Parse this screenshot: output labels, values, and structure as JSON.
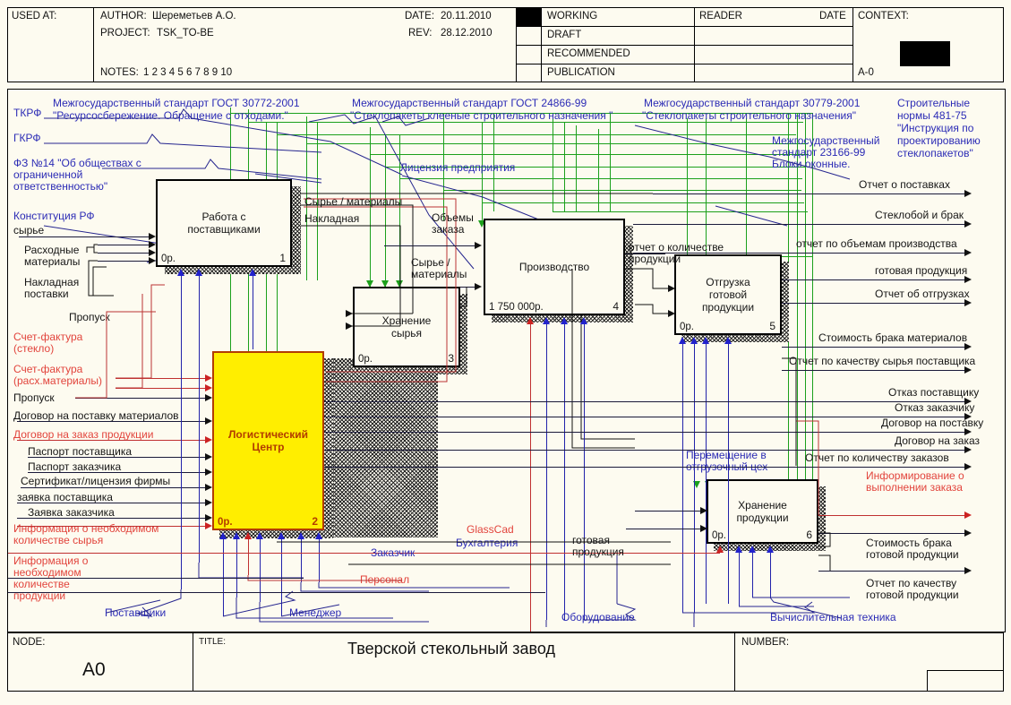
{
  "header": {
    "used_at_label": "USED AT:",
    "author_label": "AUTHOR:",
    "author_value": "Шереметьев А.О.",
    "project_label": "PROJECT:",
    "project_value": "TSK_TO-BE",
    "date_label": "DATE:",
    "date_value": "20.11.2010",
    "rev_label": "REV:",
    "rev_value": "28.12.2010",
    "notes_label": "NOTES:",
    "notes_value": "1  2  3  4  5  6  7  8  9  10",
    "status": [
      {
        "label": "WORKING",
        "checked": true
      },
      {
        "label": "DRAFT",
        "checked": false
      },
      {
        "label": "RECOMMENDED",
        "checked": false
      },
      {
        "label": "PUBLICATION",
        "checked": false
      }
    ],
    "reader_label": "READER",
    "reader_date_label": "DATE",
    "context_label": "CONTEXT:",
    "context_node": "A-0"
  },
  "footer": {
    "node_label": "NODE:",
    "node_value": "A0",
    "title_label": "TITLE:",
    "title_value": "Тверской стекольный завод",
    "number_label": "NUMBER:"
  },
  "activities": [
    {
      "id": "a1",
      "name": "Работа с\nпоставщиками",
      "cost": "0р.",
      "number": "1"
    },
    {
      "id": "a2",
      "name": "Логистический\nЦентр",
      "cost": "0р.",
      "number": "2",
      "highlight": "#ffee00"
    },
    {
      "id": "a3",
      "name": "Хранение\nсырья",
      "cost": "0р.",
      "number": "3"
    },
    {
      "id": "a4",
      "name": "Производство",
      "cost": "1 750 000р.",
      "number": "4"
    },
    {
      "id": "a5",
      "name": "Отгрузка\nготовой\nпродукции",
      "cost": "0р.",
      "number": "5"
    },
    {
      "id": "a6",
      "name": "Хранение\nпродукции",
      "cost": "0р.",
      "number": "6"
    }
  ],
  "controls_top": [
    "Межгосударственный стандарт ГОСТ 30772-2001",
    "\"Ресурсосбережение. Обращение с отходами.\"",
    "Межгосударственный стандарт ГОСТ 24866-99",
    "\"Стеклопакеты клееные строительного назначения \"",
    "Межгосударственный стандарт 30779-2001",
    "\"Стеклопакеты строительного назначения\"",
    "Межгосударственный",
    "стандарт 23166-99",
    "Блоки оконные.",
    "Строительные",
    "нормы 481-75",
    "\"Инструкция по",
    "проектированию",
    "стеклопакетов\"",
    "Лицензия предприятия"
  ],
  "labels": {
    "tkrf": "ТКРФ",
    "gkrf": "ГКРФ",
    "fz14": "ФЗ №14 \"Об обществах с\nограниченной\nответственностью\"",
    "constitution": "Конституция РФ",
    "syrye": "сырье",
    "rashodnye": "Расходные\nматериалы",
    "nakladnaya_postavki": "Накладная\nпоставки",
    "propusk1": "Пропуск",
    "schet_steklo": "Счет-фактура\n(стекло)",
    "schet_rash": "Счет-фактура\n(расх.материалы)",
    "propusk2": "Пропуск",
    "dogovor_postavku_mat": "Договор на поставку материалов",
    "dogovor_zakaz_prod": "Договор на заказ продукции",
    "pasport_postavshika": "Паспорт поставщика",
    "pasport_zakazchika": "Паспорт заказчика",
    "sertifikat": "Сертификат/лицензия фирмы",
    "zayavka_postavshika": "заявка поставщика",
    "zayavka_zakazchika": "Заявка заказчика",
    "info_syrye": "Информация о необходимом\nколичестве сырья",
    "info_produkcii": "Информация о\nнеобходимом\nколичестве\nпродукции",
    "syrye_materialy_1": "Сырье / материалы",
    "nakladnaya_1": "Накладная",
    "obyomy_zakaza": "Объемы\nзаказа",
    "syrye_materialy_2": "Сырье /\nматериалы",
    "otchet_kolichestve_prod": "отчет о количестве\nпродукции",
    "peremeshenie": "Перемещение в\nотгрузочный цех",
    "gotovaya_produkciya_mid": "готовая\nпродукция",
    "glasscad": "GlassCad",
    "buhgalteriya": "Бухгалтерия",
    "zakazchik": "Заказчик",
    "personal": "Персонал",
    "postavshiki": "Поставщики",
    "menedzher": "Менеджер",
    "oborudovanie": "Оборудование",
    "vychislitelnaya": "Вычислительная техника"
  },
  "outputs_right": [
    {
      "text": "Отчет о поставках",
      "color": "black"
    },
    {
      "text": "Стеклобой и брак",
      "color": "black"
    },
    {
      "text": "отчет по объемам производства",
      "color": "black"
    },
    {
      "text": "готовая продукция",
      "color": "black"
    },
    {
      "text": "Отчет об отгрузках",
      "color": "black"
    },
    {
      "text": "Стоимость брака материалов",
      "color": "black"
    },
    {
      "text": "Отчет по качеству сырья поставщика",
      "color": "black"
    },
    {
      "text": "Отказ поставщику",
      "color": "black"
    },
    {
      "text": "Отказ заказчику",
      "color": "black"
    },
    {
      "text": "Договор на поставку",
      "color": "black"
    },
    {
      "text": "Договор на заказ",
      "color": "black"
    },
    {
      "text": "Отчет по количеству заказов",
      "color": "black"
    },
    {
      "text": "Информирование о\nвыполнении заказа",
      "color": "red"
    },
    {
      "text": "Стоимость брака\nготовой продукции",
      "color": "black"
    },
    {
      "text": "Отчет по качеству\nготовой продукции",
      "color": "black"
    }
  ],
  "colors": {
    "paper": "#fdfbf0",
    "blue_text": "#2b2bb5",
    "red_text": "#e2443c",
    "green_arrow": "#1ca01c",
    "blue_arrow": "#2222cc",
    "red_arrow": "#cc2222",
    "highlight_box": "#ffee00",
    "highlight_border": "#b23c00"
  }
}
